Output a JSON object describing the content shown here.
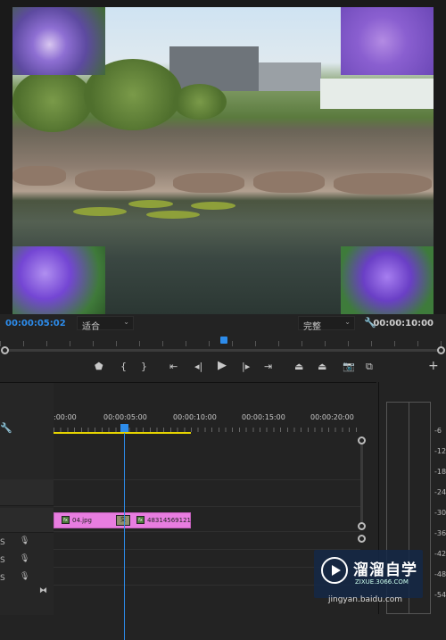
{
  "monitor": {
    "timecode_current": "00:00:05:02",
    "fit_dropdown": "适合",
    "quality_dropdown": "完整",
    "timecode_duration": "00:00:10:00"
  },
  "timeline": {
    "ruler_labels": [
      ":00:00",
      "00:00:05:00",
      "00:00:10:00",
      "00:00:15:00",
      "00:00:20:00"
    ],
    "clip1_name": "04.jpg",
    "clip2_name": "483145691217",
    "transition_label": "交",
    "audio_track_letters": [
      "S",
      "S",
      "S"
    ]
  },
  "meter": {
    "labels": [
      "-6",
      "-12",
      "-18",
      "-24",
      "-30",
      "-36",
      "-42",
      "-48",
      "-54"
    ]
  },
  "watermark": {
    "title": "溜溜自学",
    "subtitle": "ZIXUE.3066.COM",
    "url": "jingyan.baidu.com"
  },
  "colors": {
    "accent": "#2d8ceb",
    "clip": "#e87de0",
    "workarea": "#e6d400"
  }
}
